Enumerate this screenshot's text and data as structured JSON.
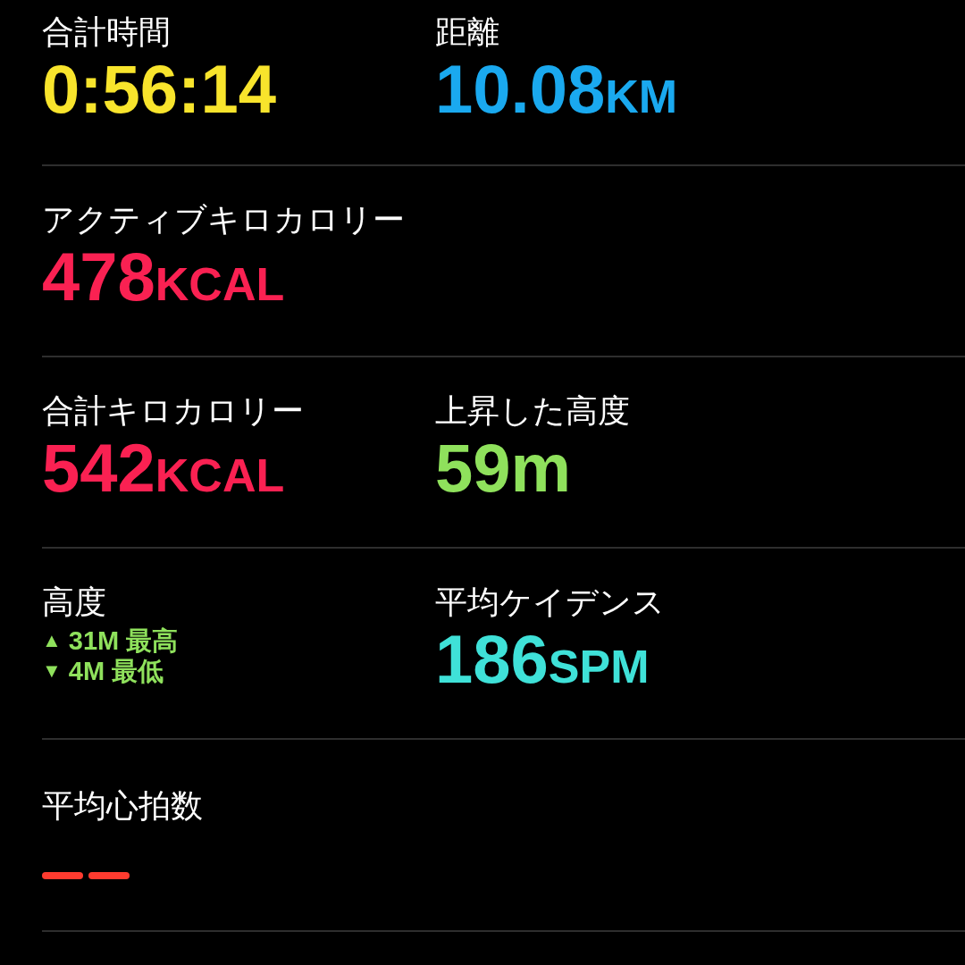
{
  "rows": [
    {
      "metrics": [
        {
          "kind": "value",
          "label": "合計時間",
          "value": "0:56:14",
          "color": "#f8e42c"
        },
        {
          "kind": "value",
          "label": "距離",
          "value": "10.08",
          "unit": "KM",
          "color": "#1aa9ef"
        }
      ]
    },
    {
      "metrics": [
        {
          "kind": "value",
          "label": "アクティブキロカロリー",
          "value": "478",
          "unit": "KCAL",
          "color": "#fa2152"
        }
      ]
    },
    {
      "metrics": [
        {
          "kind": "value",
          "label": "合計キロカロリー",
          "value": "542",
          "unit": "KCAL",
          "color": "#fa2152"
        },
        {
          "kind": "value",
          "label": "上昇した高度",
          "value": "59m",
          "color": "#8fe15c"
        }
      ]
    },
    {
      "metrics": [
        {
          "kind": "range",
          "label": "高度",
          "color": "#8fe15c",
          "high": {
            "arrow": "▲",
            "value": "31M",
            "caption": "最高"
          },
          "low": {
            "arrow": "▼",
            "value": "4M",
            "caption": "最低"
          }
        },
        {
          "kind": "value",
          "label": "平均ケイデンス",
          "value": "186",
          "unit": "SPM",
          "color": "#3fe1d8"
        }
      ]
    },
    {
      "metrics": [
        {
          "kind": "empty",
          "label": "平均心拍数",
          "color": "#ff3b2f"
        }
      ]
    }
  ]
}
